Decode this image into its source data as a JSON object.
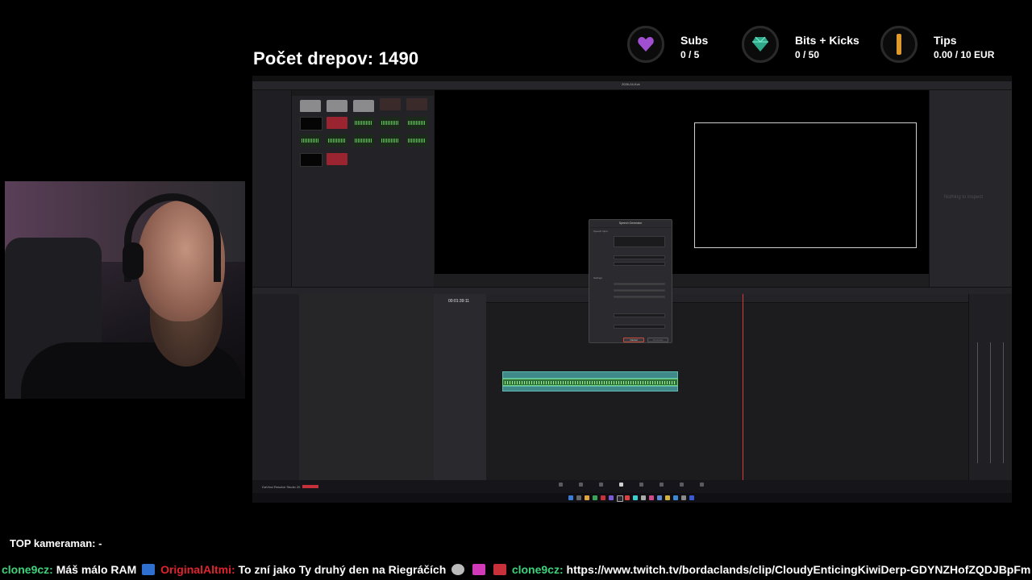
{
  "overlay": {
    "counter_label": "Počet drepov: 1490",
    "top_camera": "TOP kameraman: -",
    "goals": [
      {
        "name": "Subs",
        "value": "0 / 5",
        "icon": "purple-heart-icon",
        "color": "#a04fd0"
      },
      {
        "name": "Bits + Kicks",
        "value": "0 / 50",
        "icon": "gem-icon",
        "color": "#3fc7a8"
      },
      {
        "name": "Tips",
        "value": "0.00 / 10 EUR",
        "icon": "bar-icon",
        "color": "#e09a2a"
      }
    ]
  },
  "resolve": {
    "date": "2026-04-Kvk",
    "inspector_hint": "Nothing to inspect",
    "timecode": "00:01:39:11",
    "app_label": "DaVinci Resolve Studio 20",
    "dialog": {
      "title": "Speech Generator",
      "section_input": "Speech Input",
      "section_settings": "Settings",
      "cancel": "Cancel",
      "generate": "Generate"
    }
  },
  "chat": [
    {
      "user": "clone9cz:",
      "message": "Máš málo RAM",
      "emote": "cat-emote-icon"
    },
    {
      "user": "OriginalAltmi:",
      "message": "To zní jako Ty druhý den na Riegráčích",
      "emote": "emote-icons",
      "highlight": true
    },
    {
      "user": "clone9cz:",
      "message": "https://www.twitch.tv/bordaclands/clip/CloudyEnticingKiwiDerp-GDYNZHofZQDJBpFm"
    }
  ]
}
